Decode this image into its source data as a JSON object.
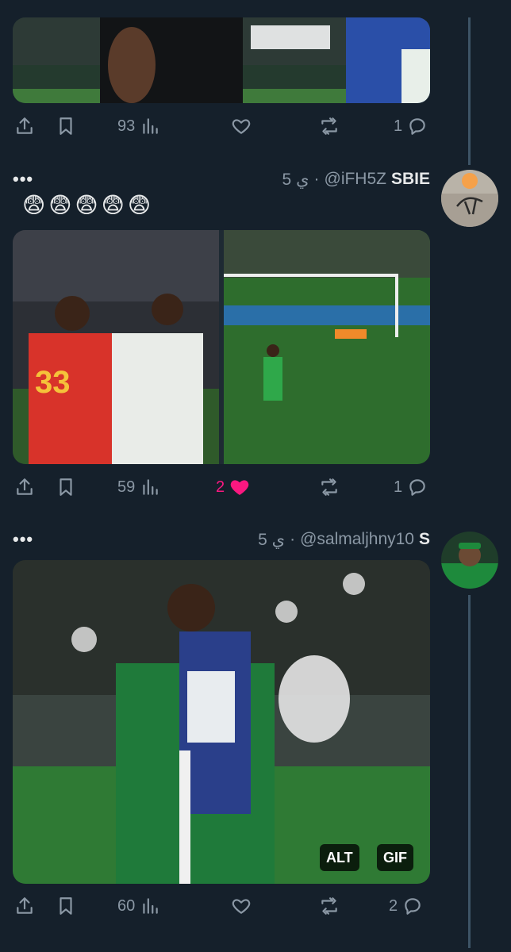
{
  "colors": {
    "background": "#15202b",
    "muted": "#8b98a5",
    "like": "#f91880",
    "thread_line": "#3d5466"
  },
  "tweets": [
    {
      "actions": {
        "views": "93",
        "likes": "",
        "retweets": "",
        "replies": "1",
        "liked": false
      }
    },
    {
      "more": "•••",
      "name": "SBIE",
      "handle": "@iFH5Z",
      "time": "5 ي",
      "separator": "·",
      "emojis": [
        "😨",
        "😨",
        "😨",
        "😨",
        "😨"
      ],
      "actions": {
        "views": "59",
        "likes": "2",
        "retweets": "",
        "replies": "1",
        "liked": true
      }
    },
    {
      "more": "•••",
      "name": "S",
      "handle": "@salmaljhny10",
      "time": "5 ي",
      "separator": "·",
      "media_badges": {
        "alt": "ALT",
        "gif": "GIF"
      },
      "actions": {
        "views": "60",
        "likes": "",
        "retweets": "",
        "replies": "2",
        "liked": false
      }
    }
  ],
  "icons": {
    "share": "share-icon",
    "bookmark": "bookmark-icon",
    "views": "views-icon",
    "like": "heart-icon",
    "retweet": "retweet-icon",
    "reply": "reply-icon"
  }
}
